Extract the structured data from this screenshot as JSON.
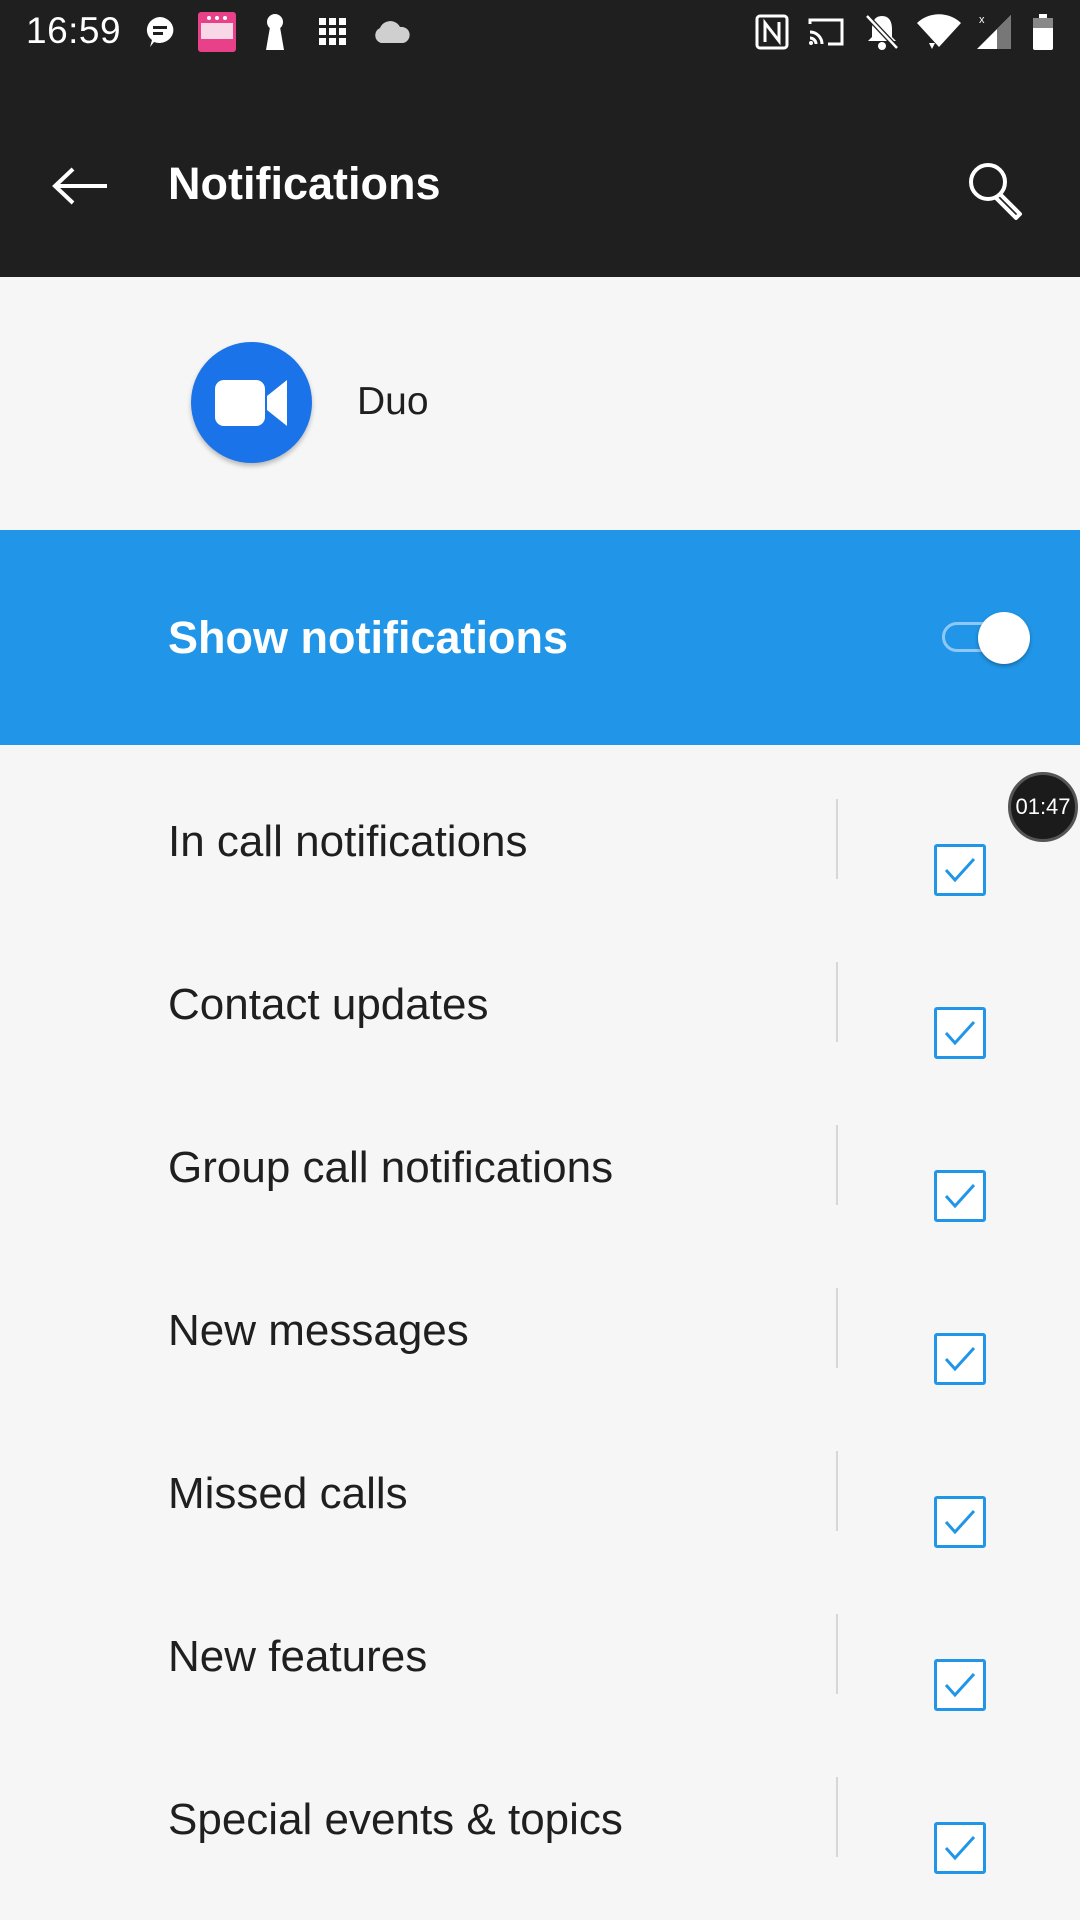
{
  "status_bar": {
    "time": "16:59",
    "left_icons": [
      "chat-bubble-icon",
      "photo-app-icon",
      "keyhole-icon",
      "grid-icon",
      "cloud-icon"
    ],
    "right_icons": [
      "nfc-icon",
      "cast-icon",
      "bell-off-icon",
      "wifi-icon",
      "signal-icon",
      "battery-icon"
    ]
  },
  "app_bar": {
    "title": "Notifications",
    "back_icon": "arrow-left-icon",
    "search_icon": "search-icon"
  },
  "app": {
    "name": "Duo",
    "icon": "video-camera-icon",
    "icon_color": "#1a73e8"
  },
  "master_toggle": {
    "label": "Show notifications",
    "enabled": true,
    "color": "#2196e8"
  },
  "timer_bubble": "01:47",
  "categories": [
    {
      "label": "In call notifications",
      "checked": true
    },
    {
      "label": "Contact updates",
      "checked": true
    },
    {
      "label": "Group call notifications",
      "checked": true
    },
    {
      "label": "New messages",
      "checked": true
    },
    {
      "label": "Missed calls",
      "checked": true
    },
    {
      "label": "New features",
      "checked": true
    },
    {
      "label": "Special events & topics",
      "checked": true
    }
  ]
}
